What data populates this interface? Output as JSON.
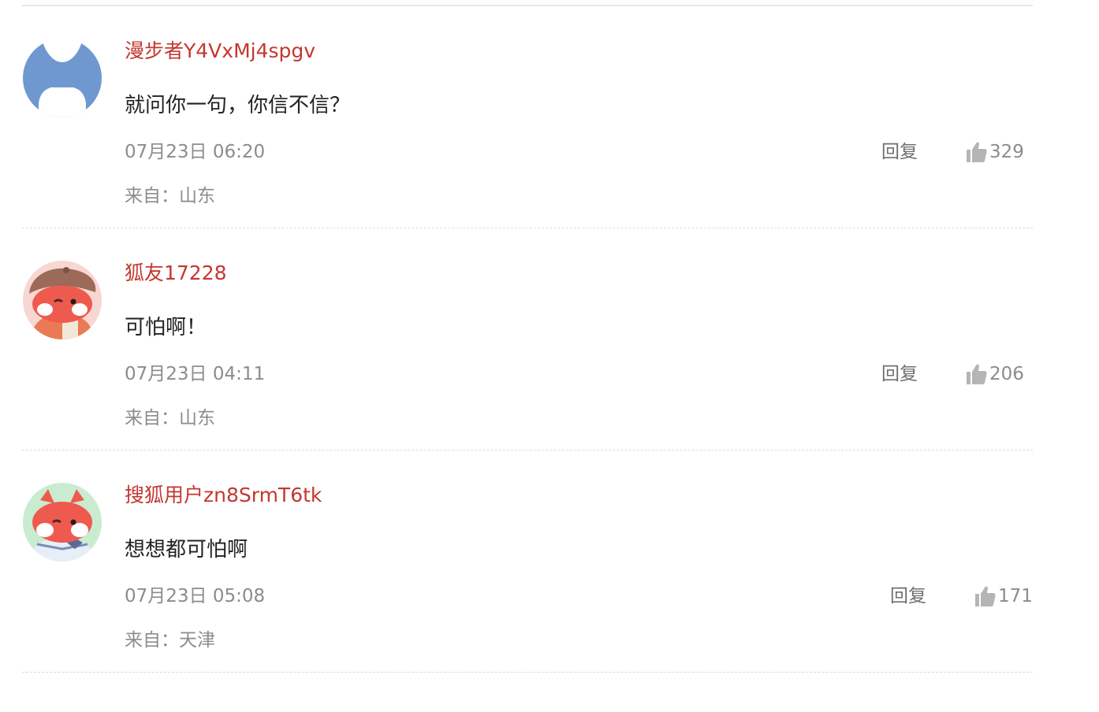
{
  "comments": [
    {
      "username": "漫步者Y4VxMj4spgv",
      "avatar_icon": "default-cat-silhouette-avatar",
      "text": "就问你一句，你信不信？",
      "time": "07月23日 06:20",
      "location_label": "来自：",
      "location": "山东",
      "reply_label": "回复",
      "like_icon": "thumbs-up-icon",
      "likes": "329"
    },
    {
      "username": "狐友17228",
      "avatar_icon": "fox-with-beret-avatar",
      "text": "可怕啊！",
      "time": "07月23日 04:11",
      "location_label": "来自：",
      "location": "山东",
      "reply_label": "回复",
      "like_icon": "thumbs-up-icon",
      "likes": "206"
    },
    {
      "username": "搜狐用户zn8SrmT6tk",
      "avatar_icon": "fox-sailor-avatar",
      "text": "想想都可怕啊",
      "time": "07月23日 05:08",
      "location_label": "来自：",
      "location": "天津",
      "reply_label": "回复",
      "like_icon": "thumbs-up-icon",
      "likes": "171"
    }
  ],
  "colors": {
    "username": "#c4372f",
    "meta": "#8c8c8c",
    "content": "#222222"
  }
}
